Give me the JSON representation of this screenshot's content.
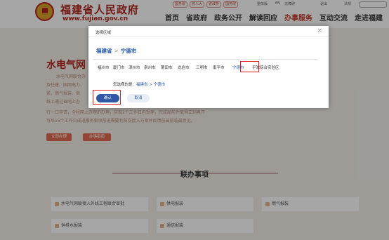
{
  "header": {
    "site_title": "福建省人民政府",
    "site_url": "www.fujian.gov.cn",
    "top_links": [
      "国务院",
      "省人大",
      "省政协",
      "国务院"
    ],
    "util_1": "整体版",
    "util_2": "EN",
    "util_3": "无障碍",
    "util_4": "退出",
    "util_5": "法规",
    "search_placeholder": "",
    "nav": [
      "首页",
      "省政府",
      "政务公开",
      "解读回应",
      "办事服务",
      "互动交流",
      "走进福建"
    ],
    "active_nav": "办事服务"
  },
  "content": {
    "title": "水电气网",
    "para_lines": [
      "水电气网联合办",
      "及任建、国网电力、",
      "紧、燃气报装、供",
      "线上通过省网上办",
      "行一口申请，全程网上办理的办理，实现2个工作日内受理，完成局前件取得立刻再开",
      "可后15个工作日成道报务事项前进需要利前交接入方案并反馈前最前装最意见。"
    ],
    "apply_button": "立即办理",
    "guide_button": "办事指南",
    "section_title": "联办事项",
    "items": [
      "水电气网联接入外线工程联合审批",
      "供电报装",
      "燃气报装",
      "供排水报装",
      "通信报装"
    ]
  },
  "modal": {
    "title": "选择区域",
    "close": "×",
    "crumb_province": "福建省",
    "crumb_sep": ">",
    "crumb_city": "宁德市",
    "cities": [
      "福州市",
      "厦门市",
      "漳州市",
      "泉州市",
      "莆田市",
      "龙岩市",
      "三明市",
      "南平市",
      "宁德市",
      "平潭综合实验区"
    ],
    "selected_city": "宁德市",
    "selected_label": "您选择的是：",
    "selected_value": "福建省 > 宁德市",
    "confirm_button": "确认",
    "cancel_button": "取消"
  }
}
